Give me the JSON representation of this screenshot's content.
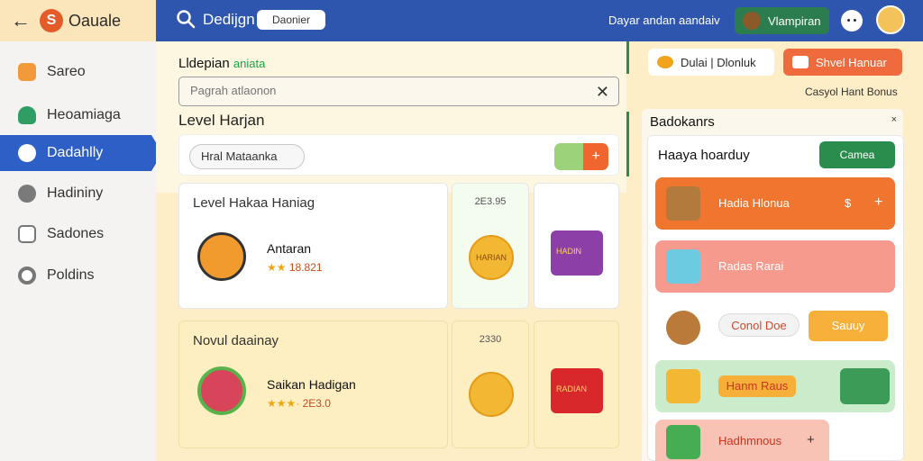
{
  "brand": {
    "name": "Oauale"
  },
  "sidebar": {
    "items": [
      {
        "label": "Sareo",
        "color": "#f29a3b"
      },
      {
        "label": "Heoamiaga",
        "color": "#2f9d64"
      },
      {
        "label": "Dadahlly",
        "color": "#2d5fc6"
      },
      {
        "label": "Hadininy",
        "color": "#6f6f6f"
      },
      {
        "label": "Sadones",
        "color": "#6f6f6f"
      },
      {
        "label": "Poldins",
        "color": "#6f6f6f"
      }
    ]
  },
  "header": {
    "title": "Dedijgn",
    "pill": "Daonier",
    "status": "Dayar andan aandaiv",
    "user_badge": "Vlampiran",
    "emoji": "• •"
  },
  "main": {
    "title": "Lldepian",
    "title_tag": "aniata",
    "search_placeholder": "Pagrah atlaonon",
    "level_heading": "Level Harjan",
    "filter_chip": "Hral Mataanka",
    "cards": [
      {
        "title": "Level Hakaa Haniag",
        "name": "Antaran",
        "stars": "★★",
        "rating": "18.821",
        "price": "2E3.95",
        "coin": "HARIAN",
        "chest": "HADIN"
      },
      {
        "title": "Novul daainay",
        "name": "Saikan Hadigan",
        "stars": "★★★·",
        "rating": "2E3.0",
        "price": "2330",
        "coin": "",
        "chest": "RADIAN"
      }
    ]
  },
  "right": {
    "btn_left": "Dulai | Dlonluk",
    "btn_right": "Shvel Hanuar",
    "note": "Casyol Hant Bonus",
    "panel_title": "Badokanrs",
    "close": "×",
    "head": "Haaya hoarduy",
    "canvas_btn": "Camea",
    "items": [
      {
        "label": "Hadia Hlonua",
        "action": "+",
        "extra": "$"
      },
      {
        "label": "Radas Rarai",
        "action": "",
        "extra": ""
      },
      {
        "label": "Conol Doe",
        "action": "Sauuy",
        "extra": ""
      },
      {
        "label": "Hanm Raus",
        "action": "",
        "extra": ""
      },
      {
        "label": "Hadhmnous",
        "action": "+",
        "extra": ""
      }
    ]
  }
}
